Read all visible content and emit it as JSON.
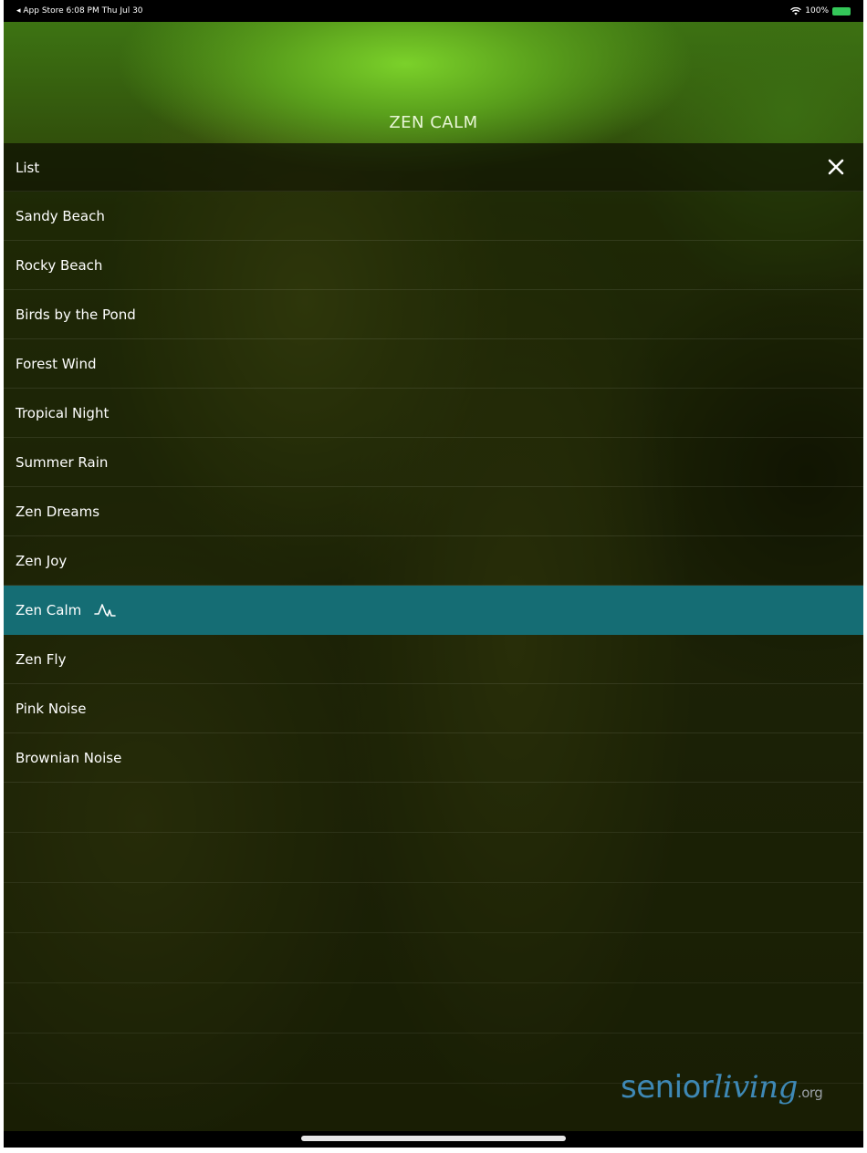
{
  "status_bar": {
    "left": "◂ App Store  6:08 PM  Thu Jul 30",
    "right_text": "100%"
  },
  "header": {
    "title": "ZEN CALM"
  },
  "list": {
    "title": "List",
    "items": [
      {
        "label": "Sandy Beach",
        "active": false
      },
      {
        "label": "Rocky Beach",
        "active": false
      },
      {
        "label": "Birds by the Pond",
        "active": false
      },
      {
        "label": "Forest Wind",
        "active": false
      },
      {
        "label": "Tropical Night",
        "active": false
      },
      {
        "label": "Summer Rain",
        "active": false
      },
      {
        "label": "Zen Dreams",
        "active": false
      },
      {
        "label": "Zen Joy",
        "active": false
      },
      {
        "label": "Zen Calm",
        "active": true
      },
      {
        "label": "Zen Fly",
        "active": false
      },
      {
        "label": "Pink Noise",
        "active": false
      },
      {
        "label": "Brownian Noise",
        "active": false
      }
    ]
  },
  "watermark": {
    "part1": "senior",
    "part2": "living",
    "tld": ".org"
  },
  "colors": {
    "active_row": "#156d74",
    "watermark": "#3e88b5"
  },
  "icons": {
    "close": "close-icon",
    "now_playing": "waveform-icon",
    "wifi": "wifi-icon",
    "battery": "battery-icon"
  }
}
